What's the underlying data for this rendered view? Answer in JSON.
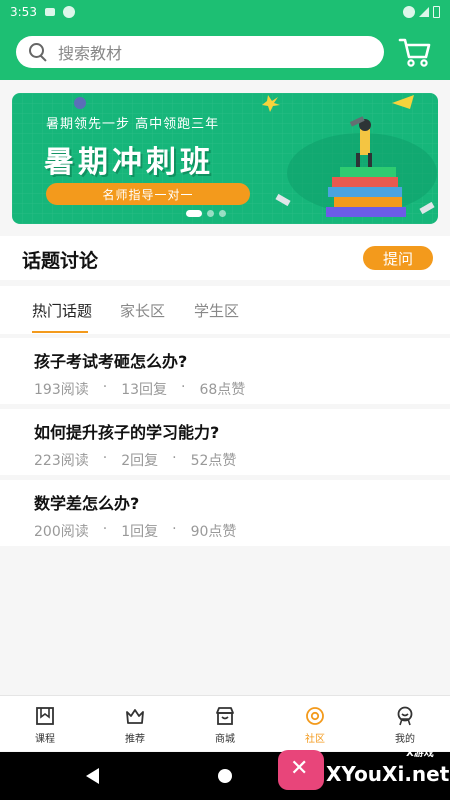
{
  "status_bar": {
    "time": "3:53"
  },
  "search": {
    "placeholder": "搜索教材"
  },
  "banner": {
    "subtitle": "暑期领先一步 高中领跑三年",
    "title": "暑期冲刺班",
    "tag": "名师指导一对一"
  },
  "topics": {
    "title": "话题讨论",
    "ask_label": "提问",
    "tabs": [
      {
        "label": "热门话题",
        "active": true
      },
      {
        "label": "家长区",
        "active": false
      },
      {
        "label": "学生区",
        "active": false
      }
    ],
    "posts": [
      {
        "title": "孩子考试考砸怎么办?",
        "reads": "193阅读",
        "replies": "13回复",
        "likes": "68点赞"
      },
      {
        "title": "如何提升孩子的学习能力?",
        "reads": "223阅读",
        "replies": "2回复",
        "likes": "52点赞"
      },
      {
        "title": "数学差怎么办?",
        "reads": "200阅读",
        "replies": "1回复",
        "likes": "90点赞"
      }
    ],
    "separator": "·"
  },
  "bottom_nav": [
    {
      "label": "课程",
      "icon": "course-icon",
      "active": false
    },
    {
      "label": "推荐",
      "icon": "crown-icon",
      "active": false
    },
    {
      "label": "商城",
      "icon": "store-icon",
      "active": false
    },
    {
      "label": "社区",
      "icon": "community-icon",
      "active": true
    },
    {
      "label": "我的",
      "icon": "profile-icon",
      "active": false
    }
  ],
  "watermark": {
    "text": "XYouXi.net",
    "small": "X游戏"
  },
  "colors": {
    "primary": "#1dbf73",
    "accent": "#f39a1c"
  }
}
